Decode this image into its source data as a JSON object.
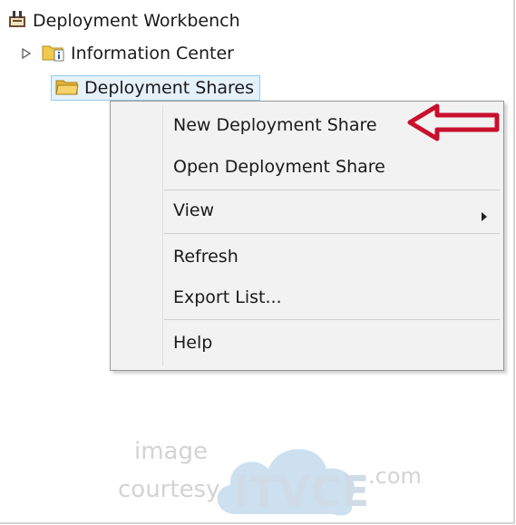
{
  "tree": {
    "root_label": "Deployment Workbench",
    "items": [
      {
        "label": "Information Center"
      },
      {
        "label": "Deployment Shares"
      }
    ]
  },
  "context_menu": {
    "items": [
      {
        "label": "New Deployment Share"
      },
      {
        "label": "Open Deployment Share"
      },
      {
        "label": "View"
      },
      {
        "label": "Refresh"
      },
      {
        "label": "Export List..."
      },
      {
        "label": "Help"
      }
    ]
  },
  "annotation": {
    "arrow_color": "#c8102e"
  },
  "watermark": {
    "line1": "image",
    "line2": "courtesy",
    "brand": "ITVCE",
    "suffix": ".com"
  },
  "colors": {
    "selection_bg": "#e5f1fb",
    "selection_border": "#99c9ef",
    "menu_bg": "#f2f2f2"
  },
  "icons": [
    "workbench-icon",
    "expand-arrow-icon",
    "folder-info-icon",
    "folder-icon",
    "submenu-arrow-icon",
    "red-arrow-icon",
    "cloud-icon"
  ]
}
